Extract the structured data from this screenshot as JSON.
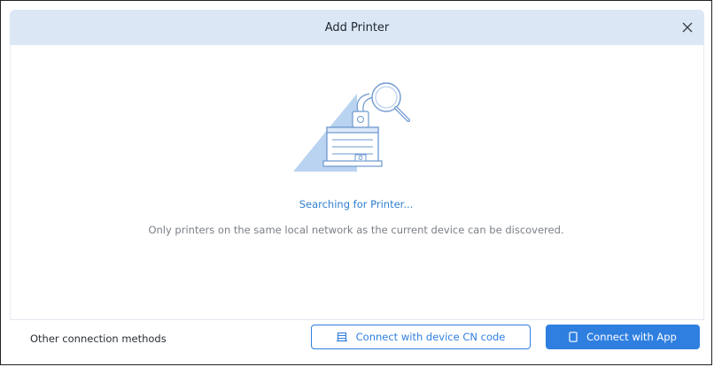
{
  "dialog": {
    "title": "Add Printer",
    "close_icon": "close-icon"
  },
  "main": {
    "illustration_icon": "printer-search-illustration",
    "status_text": "Searching for Printer...",
    "hint_text": "Only printers on the same local network as the current device can be discovered."
  },
  "footer": {
    "other_methods_label": "Other connection methods",
    "cn_code_button": {
      "label": "Connect with device CN code",
      "icon": "cn-code-icon"
    },
    "app_button": {
      "label": "Connect with App",
      "icon": "phone-icon"
    }
  },
  "colors": {
    "header_bg": "#dbe7f5",
    "accent": "#2f7fe0",
    "status_text": "#2f7fcf",
    "hint_text": "#7a7f87"
  }
}
